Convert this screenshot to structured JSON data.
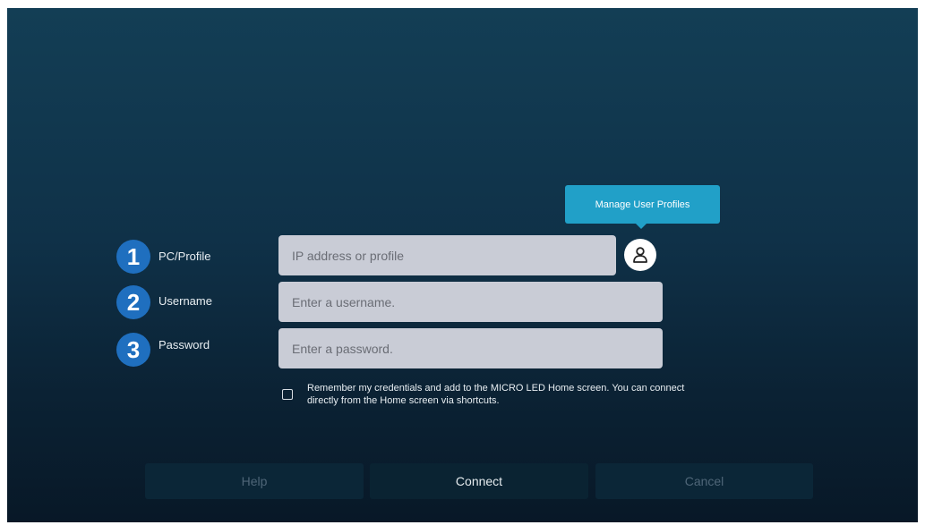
{
  "tooltip": {
    "label": "Manage User Profiles"
  },
  "fields": [
    {
      "number": "1",
      "label": "PC/Profile",
      "placeholder": "IP address or profile"
    },
    {
      "number": "2",
      "label": "Username",
      "placeholder": "Enter a username."
    },
    {
      "number": "3",
      "label": "Password",
      "placeholder": "Enter a password."
    }
  ],
  "profile_button": {
    "icon": "user-profile-icon"
  },
  "remember": {
    "text": "Remember my credentials and add to the MICRO LED Home screen. You can connect directly from the Home screen via shortcuts.",
    "checked": false
  },
  "buttons": {
    "help": "Help",
    "connect": "Connect",
    "cancel": "Cancel"
  },
  "colors": {
    "badge": "#1f6fbf",
    "tooltip": "#21a0c8",
    "input_bg": "#c9ccd6",
    "background_top": "#133e55",
    "background_bottom": "#081827"
  }
}
